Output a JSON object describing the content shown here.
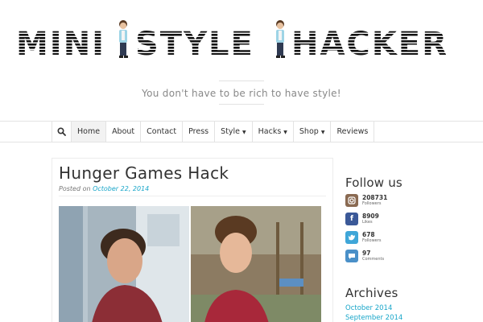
{
  "header": {
    "logo_words": [
      "MINI",
      "STYLE",
      "HACKER"
    ],
    "tagline": "You don't have to be rich to have style!"
  },
  "nav": {
    "search_icon": "search-icon",
    "items": [
      {
        "label": "Home",
        "active": true,
        "dropdown": false
      },
      {
        "label": "About",
        "active": false,
        "dropdown": false
      },
      {
        "label": "Contact",
        "active": false,
        "dropdown": false
      },
      {
        "label": "Press",
        "active": false,
        "dropdown": false
      },
      {
        "label": "Style",
        "active": false,
        "dropdown": true
      },
      {
        "label": "Hacks",
        "active": false,
        "dropdown": true
      },
      {
        "label": "Shop",
        "active": false,
        "dropdown": true
      },
      {
        "label": "Reviews",
        "active": false,
        "dropdown": false
      }
    ]
  },
  "post": {
    "title": "Hunger Games Hack",
    "posted_on_label": "Posted on",
    "date": "October 22, 2014"
  },
  "sidebar": {
    "follow_title": "Follow us",
    "follow": [
      {
        "network": "instagram-icon",
        "count": "208731",
        "label": "Followers",
        "color": "#8a6a52"
      },
      {
        "network": "facebook-icon",
        "count": "8909",
        "label": "Likes",
        "color": "#3b5998"
      },
      {
        "network": "twitter-icon",
        "count": "678",
        "label": "Followers",
        "color": "#3fa6d8"
      },
      {
        "network": "comments-icon",
        "count": "97",
        "label": "Comments",
        "color": "#4a90c8"
      }
    ],
    "archives_title": "Archives",
    "archives": [
      "October 2014",
      "September 2014"
    ]
  },
  "colors": {
    "link": "#19a6c9",
    "border": "#e3e3e3",
    "logo": "#111111"
  }
}
